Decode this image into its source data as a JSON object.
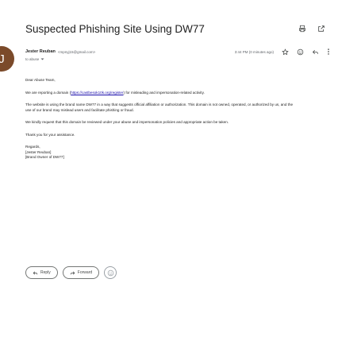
{
  "email": {
    "subject": "Suspected Phishing Site Using DW77",
    "avatar_letter": "J",
    "sender_name": "Jester Reuban",
    "sender_email": "<mpnyj15@gmail.com>",
    "timestamp": "3:44 PM (0 minutes ago)",
    "to_label": "to abuse",
    "greeting": "Dear Abuse Team,",
    "p1_before": "We are reporting a domain (",
    "p1_link": "https://castbesok10k.org/register",
    "p1_after": ") for misleading and impersonation-related activity.",
    "p2": "The website is using the brand name DW77 in a way that suggests official affiliation or authorization. This domain is not owned, operated, or authorized by us, and the use of our brand may mislead users and facilitate phishing or fraud.",
    "p3": "We kindly request that this domain be reviewed under your abuse and impersonation policies and appropriate action be taken.",
    "p4": "Thank you for your assistance.",
    "sig_regards": "Regards,",
    "sig_name": "[Jester Reuban]",
    "sig_title": "[Brand Owner of DW77]"
  },
  "actions": {
    "reply_label": "Reply",
    "forward_label": "Forward"
  },
  "icons": {
    "print": "print-icon",
    "open_new_window": "open-in-new-window-icon",
    "star": "star-icon",
    "emoji": "emoji-icon",
    "reply": "reply-icon",
    "more": "more-vert-icon",
    "dropdown": "chevron-down-icon"
  },
  "colors": {
    "avatar_bg": "#7b4a2a",
    "link": "#1a0dab"
  }
}
